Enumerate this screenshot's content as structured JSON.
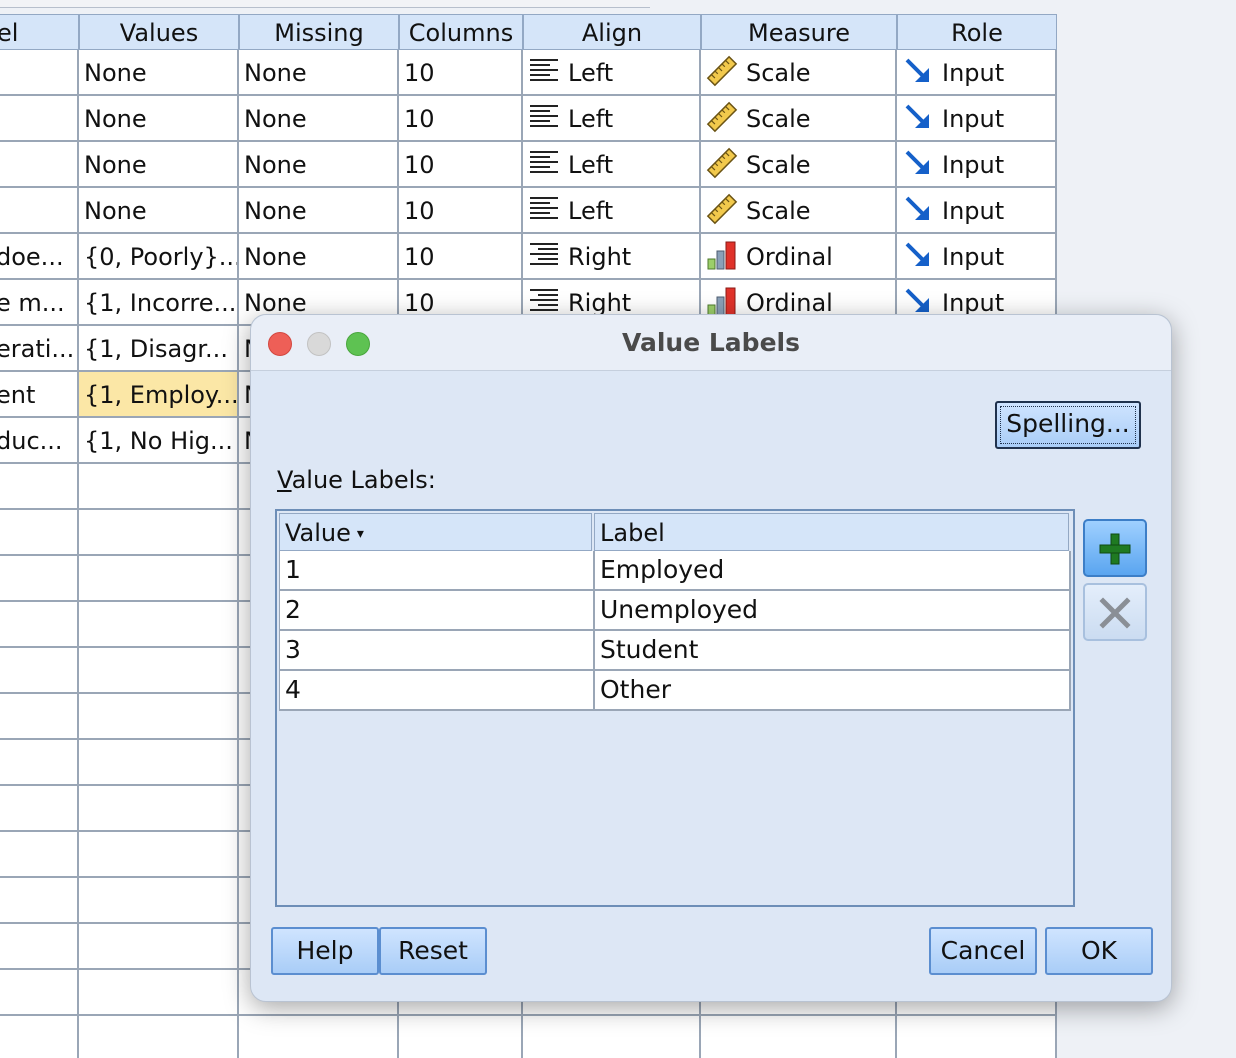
{
  "variable_view": {
    "headers": [
      "el",
      "Values",
      "Missing",
      "Columns",
      "Align",
      "Measure",
      "Role"
    ],
    "rows": [
      {
        "label": "",
        "values": "None",
        "missing": "None",
        "columns": "10",
        "align": "Left",
        "align_icon": "align-left-icon",
        "measure": "Scale",
        "measure_icon": "ruler-icon",
        "role": "Input",
        "role_icon": "input-arrow-icon"
      },
      {
        "label": "",
        "values": "None",
        "missing": "None",
        "columns": "10",
        "align": "Left",
        "align_icon": "align-left-icon",
        "measure": "Scale",
        "measure_icon": "ruler-icon",
        "role": "Input",
        "role_icon": "input-arrow-icon"
      },
      {
        "label": "",
        "values": "None",
        "missing": "None",
        "columns": "10",
        "align": "Left",
        "align_icon": "align-left-icon",
        "measure": "Scale",
        "measure_icon": "ruler-icon",
        "role": "Input",
        "role_icon": "input-arrow-icon"
      },
      {
        "label": "",
        "values": "None",
        "missing": "None",
        "columns": "10",
        "align": "Left",
        "align_icon": "align-left-icon",
        "measure": "Scale",
        "measure_icon": "ruler-icon",
        "role": "Input",
        "role_icon": "input-arrow-icon"
      },
      {
        "label": "doe...",
        "values": "{0, Poorly}...",
        "missing": "None",
        "columns": "10",
        "align": "Right",
        "align_icon": "align-right-icon",
        "measure": "Ordinal",
        "measure_icon": "ordinal-bars-icon",
        "role": "Input",
        "role_icon": "input-arrow-icon"
      },
      {
        "label": "e m...",
        "values": "{1, Incorre...",
        "missing": "None",
        "columns": "10",
        "align": "Right",
        "align_icon": "align-right-icon",
        "measure": "Ordinal",
        "measure_icon": "ordinal-bars-icon",
        "role": "Input",
        "role_icon": "input-arrow-icon"
      },
      {
        "label": "erati...",
        "values": "{1, Disagr...",
        "missing": "N"
      },
      {
        "label": "ent",
        "values": "{1, Employ...",
        "missing": "N",
        "selected": true
      },
      {
        "label": "duc...",
        "values": "{1, No Hig...",
        "missing": "N"
      }
    ],
    "empty_rows": 13
  },
  "dialog": {
    "title": "Value Labels",
    "spelling_button": "Spelling...",
    "caption_mnemonic": "V",
    "caption_rest": "alue Labels:",
    "table": {
      "columns": [
        "Value",
        "Label"
      ],
      "sort_indicator": "▾",
      "rows": [
        {
          "value": "1",
          "label": "Employed"
        },
        {
          "value": "2",
          "label": "Unemployed"
        },
        {
          "value": "3",
          "label": "Student"
        },
        {
          "value": "4",
          "label": "Other"
        }
      ]
    },
    "add_button_icon": "plus-icon",
    "remove_button_icon": "x-icon",
    "buttons": {
      "help": "Help",
      "reset": "Reset",
      "cancel": "Cancel",
      "ok": "OK"
    }
  },
  "colors": {
    "header_bg": "#d5e5f9",
    "selected_cell": "#fbe7a6",
    "button_bg": "#a9cdf7",
    "add_green": "#1f7a22",
    "close_red": "#ee5f57",
    "zoom_green": "#5ec252"
  }
}
